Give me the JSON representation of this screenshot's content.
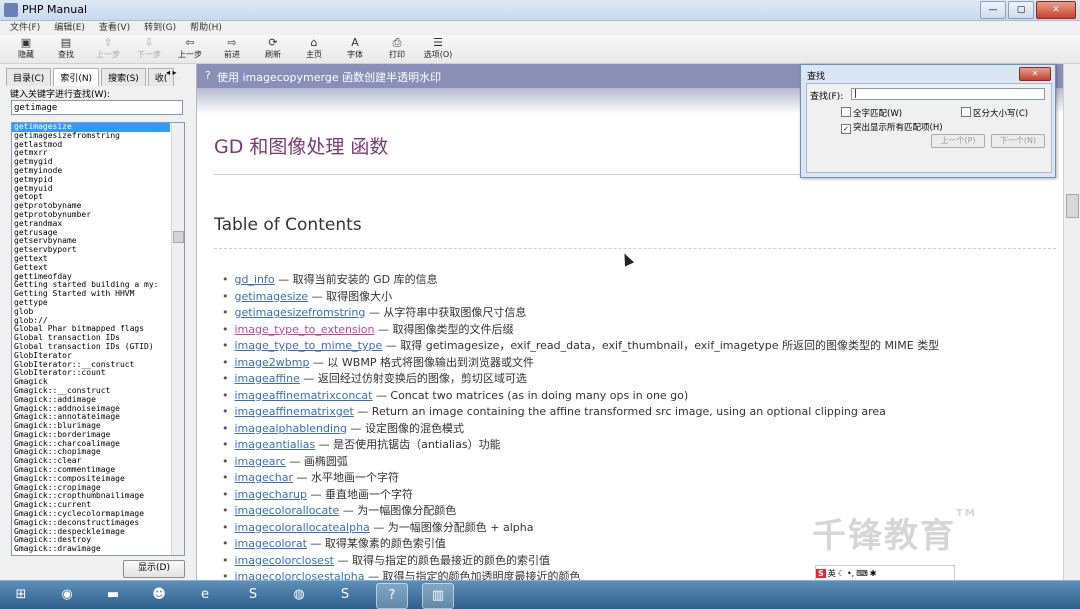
{
  "window": {
    "title": "PHP Manual",
    "buttons": [
      "—",
      "▢",
      "✕"
    ]
  },
  "menu": [
    "文件(F)",
    "编辑(E)",
    "查看(V)",
    "转到(G)",
    "帮助(H)"
  ],
  "toolbar": [
    {
      "label": "隐藏",
      "icon": "hide-icon",
      "enabled": true
    },
    {
      "label": "查找",
      "icon": "find-icon",
      "enabled": true
    },
    {
      "label": "上一步",
      "icon": "up-icon",
      "enabled": false
    },
    {
      "label": "下一步",
      "icon": "down-icon",
      "enabled": false
    },
    {
      "label": "上一步",
      "icon": "back-icon",
      "enabled": true
    },
    {
      "label": "前进",
      "icon": "forward-icon",
      "enabled": true
    },
    {
      "label": "刷新",
      "icon": "refresh-icon",
      "enabled": true
    },
    {
      "label": "主页",
      "icon": "home-icon",
      "enabled": true
    },
    {
      "label": "字体",
      "icon": "font-icon",
      "enabled": true
    },
    {
      "label": "打印",
      "icon": "print-icon",
      "enabled": true
    },
    {
      "label": "选项(O)",
      "icon": "options-icon",
      "enabled": true
    }
  ],
  "left": {
    "tabs": [
      "目录(C)",
      "索引(N)",
      "搜索(S)",
      "收(",
      "◂ ▸"
    ],
    "keyword_label": "键入关键字进行查找(W):",
    "keyword_value": "getimage",
    "index_items": [
      "getimagesize",
      "getimagesizefromstring",
      "getlastmod",
      "getmxrr",
      "getmygid",
      "getmyinode",
      "getmypid",
      "getmyuid",
      "getopt",
      "getprotobyname",
      "getprotobynumber",
      "getrandmax",
      "getrusage",
      "getservbyname",
      "getservbyport",
      "gettext",
      "Gettext",
      "gettimeofday",
      "Getting started building a my:",
      "Getting Started with HHVM",
      "gettype",
      "glob",
      "glob://",
      "Global Phar bitmapped flags",
      "Global transaction IDs",
      "Global transaction IDs (GTID)",
      "GlobIterator",
      "GlobIterator::__construct",
      "GlobIterator::count",
      "Gmagick",
      "Gmagick::__construct",
      "Gmagick::addimage",
      "Gmagick::addnoiseimage",
      "Gmagick::annotateimage",
      "Gmagick::blurimage",
      "Gmagick::borderimage",
      "Gmagick::charcoalimage",
      "Gmagick::chopimage",
      "Gmagick::clear",
      "Gmagick::commentimage",
      "Gmagick::compositeimage",
      "Gmagick::cropimage",
      "Gmagick::cropthumbnailimage",
      "Gmagick::current",
      "Gmagick::cyclecolormapimage",
      "Gmagick::deconstructimages",
      "Gmagick::despeckleimage",
      "Gmagick::destroy",
      "Gmagick::drawimage"
    ],
    "show_button": "显示(D)"
  },
  "content": {
    "header": "使用 imagecopymerge 函数创建半透明水印",
    "header_icon": "?",
    "page_title": "GD 和图像处理 函数",
    "toc_heading": "Table of Contents",
    "toc": [
      {
        "link": "gd_info",
        "desc": " — 取得当前安装的 GD 库的信息",
        "visited": false
      },
      {
        "link": "getimagesize",
        "desc": " — 取得图像大小",
        "visited": false
      },
      {
        "link": "getimagesizefromstring",
        "desc": " — 从字符串中获取图像尺寸信息",
        "visited": false
      },
      {
        "link": "image_type_to_extension",
        "desc": " — 取得图像类型的文件后缀",
        "visited": true
      },
      {
        "link": "image_type_to_mime_type",
        "desc": " — 取得 getimagesize，exif_read_data，exif_thumbnail，exif_imagetype 所返回的图像类型的 MIME 类型",
        "visited": false
      },
      {
        "link": "image2wbmp",
        "desc": " — 以 WBMP 格式将图像输出到浏览器或文件",
        "visited": false
      },
      {
        "link": "imageaffine",
        "desc": " — 返回经过仿射变换后的图像，剪切区域可选",
        "visited": false
      },
      {
        "link": "imageaffinematrixconcat",
        "desc": " — Concat two matrices (as in doing many ops in one go)",
        "visited": false
      },
      {
        "link": "imageaffinematrixget",
        "desc": " — Return an image containing the affine transformed src image, using an optional clipping area",
        "visited": false
      },
      {
        "link": "imagealphablending",
        "desc": " — 设定图像的混色模式",
        "visited": false
      },
      {
        "link": "imageantialias",
        "desc": " — 是否使用抗锯齿（antialias）功能",
        "visited": false
      },
      {
        "link": "imagearc",
        "desc": " — 画椭圆弧",
        "visited": false
      },
      {
        "link": "imagechar",
        "desc": " — 水平地画一个字符",
        "visited": false
      },
      {
        "link": "imagecharup",
        "desc": " — 垂直地画一个字符",
        "visited": false
      },
      {
        "link": "imagecolorallocate",
        "desc": " — 为一幅图像分配颜色",
        "visited": false
      },
      {
        "link": "imagecolorallocatealpha",
        "desc": " — 为一幅图像分配颜色 + alpha",
        "visited": false
      },
      {
        "link": "imagecolorat",
        "desc": " — 取得某像素的颜色索引值",
        "visited": false
      },
      {
        "link": "imagecolorclosest",
        "desc": " — 取得与指定的颜色最接近的颜色的索引值",
        "visited": false
      },
      {
        "link": "imagecolorclosestalpha",
        "desc": " — 取得与指定的颜色加透明度最接近的颜色",
        "visited": false
      }
    ]
  },
  "find_dialog": {
    "title": "查找",
    "close": "✕",
    "label": "查找(F):",
    "value": "|",
    "match_word": "全字匹配(W)",
    "match_case": "区分大小写(C)",
    "highlight": "突出显示所有匹配项(H)",
    "prev": "上一个(P)",
    "next": "下一个(N)"
  },
  "watermark": {
    "text": "千锋教育",
    "tm": "TM"
  },
  "ime": {
    "logo": "S",
    "lang": "英"
  },
  "taskbar": {
    "apps": [
      "start-icon",
      "chrome-icon",
      "explorer-icon",
      "qq-icon",
      "ie-icon",
      "sublime-icon",
      "firefox-icon",
      "sogou-icon",
      "php-manual-icon",
      "app-icon"
    ]
  }
}
